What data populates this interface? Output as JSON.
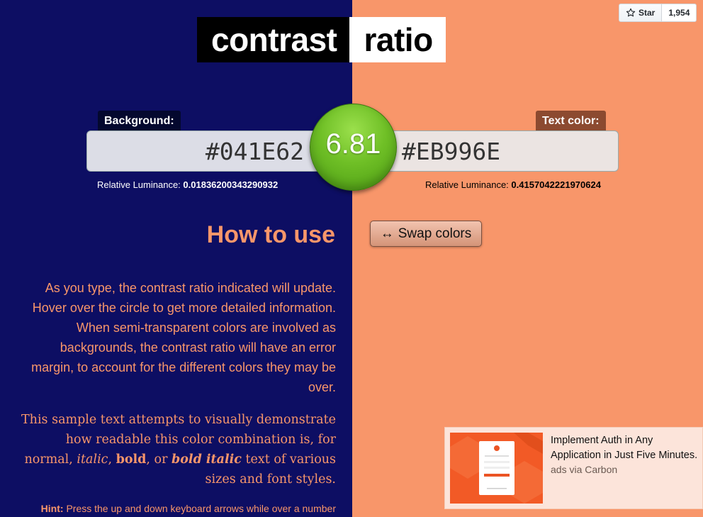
{
  "github": {
    "star_label": "Star",
    "star_count": "1,954"
  },
  "title": {
    "part1": "contrast",
    "part2": "ratio"
  },
  "background": {
    "label": "Background:",
    "value": "#041E62",
    "luminance_label": "Relative Luminance:",
    "luminance": "0.01836200343290932"
  },
  "text_color": {
    "label": "Text color:",
    "value": "#EB996E",
    "luminance_label": "Relative Luminance:",
    "luminance": "0.4157042221970624"
  },
  "ratio": "6.81",
  "swap_button": {
    "icon": "↔",
    "label": "Swap colors"
  },
  "how_to_use": {
    "heading": "How to use",
    "paragraph": "As you type, the contrast ratio indicated will update. Hover over the circle to get more detailed information. When semi-transparent colors are involved as backgrounds, the contrast ratio will have an error margin, to account for the different colors they may be over.",
    "sample": {
      "part1": "This sample text attempts to visually demonstrate how readable this color combination is, for normal, ",
      "italic": "italic",
      "comma": ", ",
      "bold": "bold",
      "or": ", or ",
      "bold_italic": "bold italic",
      "part2": " text of various sizes and font styles."
    },
    "hint_label": "Hint:",
    "hint_text": "Press the up and down keyboard arrows while over a number"
  },
  "ad": {
    "text": "Implement Auth in Any Application in Just Five Minutes.",
    "via": "ads via Carbon"
  },
  "colors": {
    "left_bg": "#0d0e63",
    "right_bg": "#f8966a",
    "circle": "#6fbf26"
  }
}
